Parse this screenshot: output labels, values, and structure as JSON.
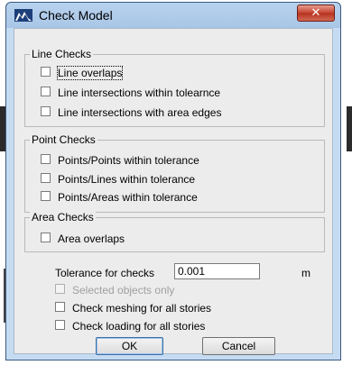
{
  "window": {
    "title": "Check Model",
    "close_symbol": "✕"
  },
  "line_checks": {
    "title": "Line Checks",
    "items": [
      {
        "label": "Line overlaps",
        "checked": false
      },
      {
        "label": "Line intersections within tolearnce",
        "checked": false
      },
      {
        "label": "Line intersections with area edges",
        "checked": false
      }
    ]
  },
  "point_checks": {
    "title": "Point Checks",
    "items": [
      {
        "label": "Points/Points within tolerance",
        "checked": false
      },
      {
        "label": "Points/Lines within tolerance",
        "checked": false
      },
      {
        "label": "Points/Areas within tolerance",
        "checked": false
      }
    ]
  },
  "area_checks": {
    "title": "Area Checks",
    "items": [
      {
        "label": "Area overlaps",
        "checked": false
      }
    ]
  },
  "tolerance": {
    "label": "Tolerance for checks",
    "value": "0.001",
    "unit": "m"
  },
  "options": [
    {
      "label": "Selected objects only",
      "checked": false,
      "enabled": false
    },
    {
      "label": "Check meshing for all stories",
      "checked": false,
      "enabled": true
    },
    {
      "label": "Check loading for all stories",
      "checked": false,
      "enabled": true
    }
  ],
  "buttons": {
    "ok": "OK",
    "cancel": "Cancel"
  }
}
